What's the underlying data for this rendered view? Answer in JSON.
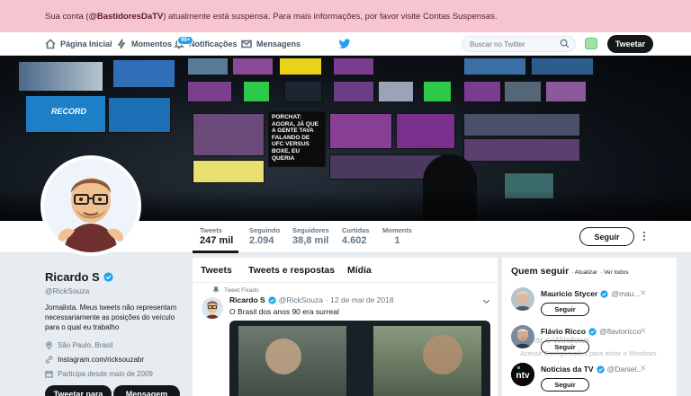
{
  "alert": {
    "prefix": "Sua conta (",
    "handle": "@BastidoresDaTV",
    "suffix": ") atualmente está suspensa. Para mais informações, por favor visite Contas Suspensas."
  },
  "nav": {
    "home": "Página Inicial",
    "moments": "Momentos",
    "notifications": "Notificações",
    "notifications_badge": "99+",
    "messages": "Mensagens",
    "search_placeholder": "Buscar no Twitter",
    "tweet_button": "Tweetar"
  },
  "profile_nav": {
    "stats": [
      {
        "label": "Tweets",
        "value": "247 mil",
        "active": true
      },
      {
        "label": "Seguindo",
        "value": "2.094",
        "active": false
      },
      {
        "label": "Seguidores",
        "value": "38,8 mil",
        "active": false
      },
      {
        "label": "Curtidas",
        "value": "4.602",
        "active": false
      },
      {
        "label": "Moments",
        "value": "1",
        "active": false
      }
    ],
    "follow_button": "Seguir"
  },
  "banner": {
    "record_logo": "RECORD",
    "caption_lines": [
      "PORCHAT:",
      "AGORA, JÁ QUE",
      "A GENTE TAVA",
      "FALANDO DE",
      "UFC VERSUS",
      "BOXE, EU",
      "QUERIA"
    ]
  },
  "profile": {
    "name": "Ricardo S",
    "handle": "@RickSouza",
    "bio": "Jornalista. Meus tweets não representam necessariamente as posições do veículo para o qual eu trabalho",
    "location": "São Paulo, Brasil",
    "website": "Instagram.com/ricksouzabr",
    "joined": "Participa desde maio de 2009",
    "buttons": [
      "Tweetar para",
      "Mensagem"
    ]
  },
  "timeline": {
    "tabs": [
      "Tweets",
      "Tweets e respostas",
      "Mídia"
    ],
    "pinned_label": "Tweet Fixado",
    "tweet": {
      "name": "Ricardo S",
      "handle": "@RickSouza",
      "date": "· 12 de mai de 2018",
      "text": "O Brasil dos anos 90 era surreal"
    }
  },
  "who_to_follow": {
    "title": "Quem seguir",
    "update": "· Atualizar",
    "view_all": "· Ver todos",
    "suggestions": [
      {
        "name": "Mauricio Stycer",
        "handle": "@mau...",
        "button": "Seguir"
      },
      {
        "name": "Flávio Ricco",
        "handle": "@flavioricco",
        "button": "Seguir"
      },
      {
        "name": "Notícias da TV",
        "handle": "@Daniel...",
        "button": "Seguir"
      }
    ]
  },
  "watermark": {
    "line1": "Ativar o Windows",
    "line2": "Acesse Configurações para ativar o Windows."
  },
  "colors": {
    "accent": "#1da1f2",
    "alert_bg": "#f5c6d0",
    "dark": "#14171a"
  }
}
